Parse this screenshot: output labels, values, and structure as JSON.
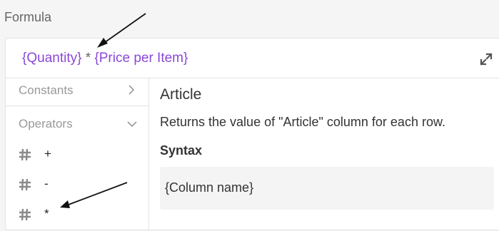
{
  "field": {
    "label": "Formula"
  },
  "formula": {
    "tokens": [
      {
        "text": "{Quantity}",
        "kind": "column"
      },
      {
        "text": " * ",
        "kind": "operator"
      },
      {
        "text": "{Price per Item}",
        "kind": "column"
      }
    ]
  },
  "icons": {
    "expand": "expand-icon",
    "hash": "hash-icon",
    "chevron_right": "chevron-right-icon",
    "chevron_down": "chevron-down-icon"
  },
  "sidebar": {
    "constants_label": "Constants",
    "operators_label": "Operators",
    "operators": [
      {
        "label": "+"
      },
      {
        "label": "-"
      },
      {
        "label": "*"
      }
    ]
  },
  "detail": {
    "title": "Article",
    "description": "Returns the value of \"Article\" column for each row.",
    "syntax_heading": "Syntax",
    "syntax": "{Column name}"
  },
  "colors": {
    "column_token": "#8a48d9",
    "operator_token": "#666666",
    "accent": "#8a48d9"
  }
}
